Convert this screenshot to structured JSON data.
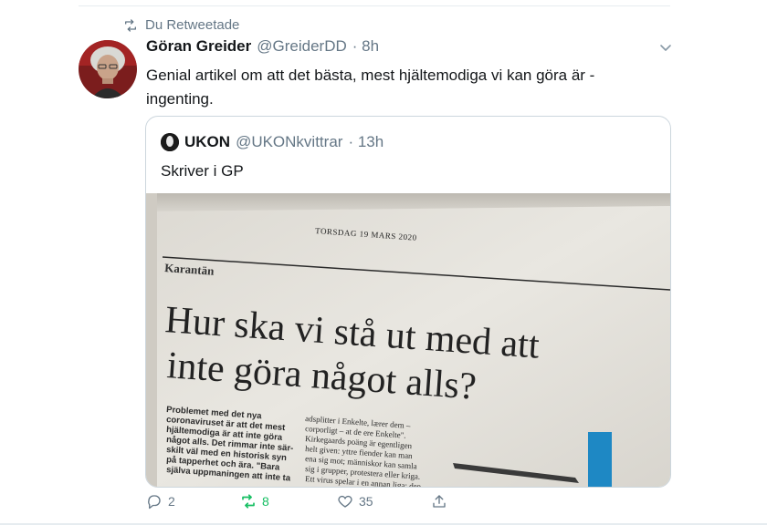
{
  "retweet_note": "Du Retweetade",
  "author": {
    "name": "Göran Greider",
    "handle": "@GreiderDD",
    "time": "· 8h"
  },
  "tweet_text": "Genial artikel om att det bästa, mest hjältemodiga vi kan göra är - ingenting.",
  "quote": {
    "name": "UKON",
    "handle": "@UKONkvittrar",
    "time": "· 13h",
    "text": "Skriver i GP",
    "photo": {
      "date_line": "TORSDAG 19 MARS 2020",
      "section": "Karantän",
      "headline_1": "Hur ska vi stå ut med att",
      "headline_2": "inte göra något alls?",
      "col1": [
        "Problemet med det nya",
        "coronaviruset är att det mest",
        "hjältemodiga är att inte göra",
        "något alls. Det rimmar inte sär-",
        "skilt väl med en historisk syn",
        "på tapperhet och ära. \"Bara",
        "själva uppmaningen att inte ta"
      ],
      "col2": [
        "adsplitter i Enkelte, lærer dem –",
        "corporligt – at de ere Enkelte\".",
        "Kirkegaards poäng är egentligen",
        "helt given: yttre fiender kan man",
        "ena sig mot; människor kan samla",
        "sig i grupper, protestera eller kriga.",
        "Ett virus spelar i en annan liga; den"
      ]
    }
  },
  "actions": {
    "replies": "2",
    "retweets": "8",
    "likes": "35"
  },
  "colors": {
    "retweet_active": "#17bf63",
    "muted": "#657786",
    "border": "#ccd6dd"
  }
}
